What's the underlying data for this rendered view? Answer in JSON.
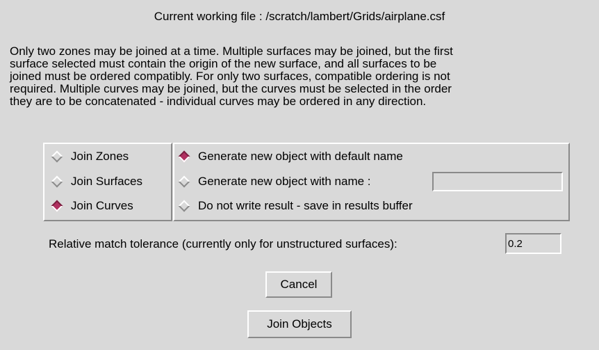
{
  "header": {
    "title": "Current working file : /scratch/lambert/Grids/airplane.csf"
  },
  "info_lines": [
    "Only two zones may be joined at a time.  Multiple  surfaces may be joined, but the first",
    "surface selected must contain the  origin of the new surface, and all surfaces to be",
    "joined must be ordered  compatibly.  For only two surfaces, compatible ordering is not",
    "required.  Multiple curves may be joined, but the curves must be selected  in the order",
    "they are to be concatenated - individual curves may be ordered  in any direction."
  ],
  "join_type": {
    "selected": "Join Curves",
    "options": [
      {
        "label": "Join Zones",
        "selected": false
      },
      {
        "label": "Join Surfaces",
        "selected": false
      },
      {
        "label": "Join Curves",
        "selected": true
      }
    ]
  },
  "output_mode": {
    "selected": "Generate new object with default name",
    "options": [
      {
        "label": "Generate new object with default name",
        "selected": true
      },
      {
        "label": "Generate new object with name :",
        "selected": false
      },
      {
        "label": "Do not write result - save in results buffer",
        "selected": false
      }
    ],
    "name_value": ""
  },
  "tolerance": {
    "label": "Relative match tolerance (currently only for  unstructured surfaces):",
    "value": "0.2"
  },
  "buttons": {
    "cancel": "Cancel",
    "join": "Join Objects"
  },
  "colors": {
    "background": "#d9d9d9",
    "radio_selected": "#b03060"
  },
  "icons": {
    "radio_unselected": "diamond-outline",
    "radio_selected": "diamond-filled"
  }
}
